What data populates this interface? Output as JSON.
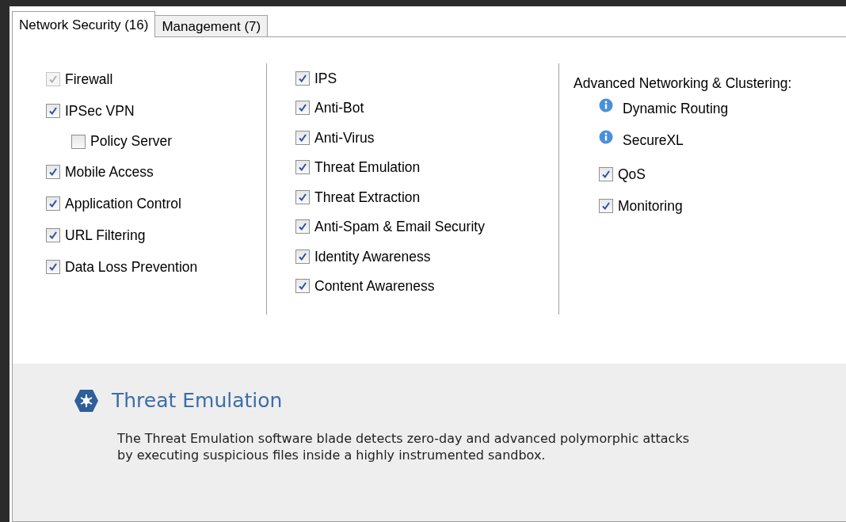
{
  "tabs": [
    {
      "label": "Network Security (16)",
      "selected": true
    },
    {
      "label": "Management (7)",
      "selected": false
    }
  ],
  "columns": [
    {
      "items": [
        {
          "kind": "checkbox",
          "label": "Firewall",
          "checked": true,
          "disabled": true
        },
        {
          "kind": "checkbox",
          "label": "IPSec VPN",
          "checked": true,
          "disabled": false,
          "children": [
            {
              "kind": "checkbox",
              "label": "Policy Server",
              "checked": false,
              "disabled": false
            }
          ]
        },
        {
          "kind": "checkbox",
          "label": "Mobile Access",
          "checked": true,
          "disabled": false
        },
        {
          "kind": "checkbox",
          "label": "Application Control",
          "checked": true,
          "disabled": false
        },
        {
          "kind": "checkbox",
          "label": "URL Filtering",
          "checked": true,
          "disabled": false
        },
        {
          "kind": "checkbox",
          "label": "Data Loss Prevention",
          "checked": true,
          "disabled": false
        }
      ]
    },
    {
      "items": [
        {
          "kind": "checkbox",
          "label": "IPS",
          "checked": true,
          "disabled": false
        },
        {
          "kind": "checkbox",
          "label": "Anti-Bot",
          "checked": true,
          "disabled": false
        },
        {
          "kind": "checkbox",
          "label": "Anti-Virus",
          "checked": true,
          "disabled": false
        },
        {
          "kind": "checkbox",
          "label": "Threat Emulation",
          "checked": true,
          "disabled": false
        },
        {
          "kind": "checkbox",
          "label": "Threat Extraction",
          "checked": true,
          "disabled": false
        },
        {
          "kind": "checkbox",
          "label": "Anti-Spam & Email Security",
          "checked": true,
          "disabled": false
        },
        {
          "kind": "checkbox",
          "label": "Identity Awareness",
          "checked": true,
          "disabled": false
        },
        {
          "kind": "checkbox",
          "label": "Content Awareness",
          "checked": true,
          "disabled": false
        }
      ]
    },
    {
      "heading": "Advanced Networking & Clustering:",
      "items": [
        {
          "kind": "info",
          "label": "Dynamic Routing"
        },
        {
          "kind": "info",
          "label": "SecureXL"
        },
        {
          "kind": "checkbox",
          "label": "QoS",
          "checked": true,
          "disabled": false
        },
        {
          "kind": "checkbox",
          "label": "Monitoring",
          "checked": true,
          "disabled": false
        }
      ]
    }
  ],
  "details": {
    "title": "Threat Emulation",
    "description": "The Threat Emulation software blade detects zero-day and advanced polymorphic attacks by executing suspicious files inside a highly instrumented sandbox."
  }
}
